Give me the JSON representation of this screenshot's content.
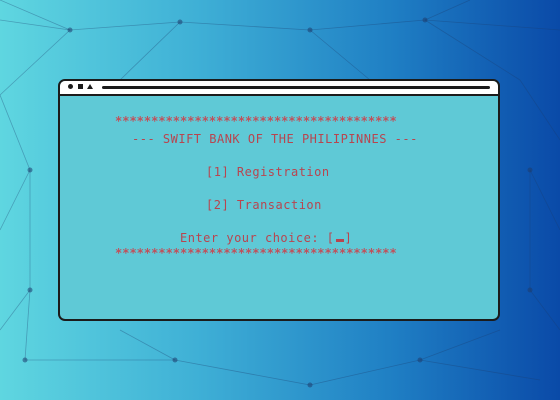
{
  "terminal": {
    "border_line": "***************************************",
    "bank_title": "--- SWIFT BANK OF THE PHILIPINNES ---",
    "menu": [
      {
        "label": "[1] Registration"
      },
      {
        "label": "[2] Transaction"
      }
    ],
    "prompt": "Enter your choice:",
    "input_open": "[",
    "input_close": "]"
  },
  "colors": {
    "text": "#b8454f",
    "window_bg": "#5fc9d6",
    "bg_left": "#5fd6e0",
    "bg_right": "#0a4aa8"
  }
}
